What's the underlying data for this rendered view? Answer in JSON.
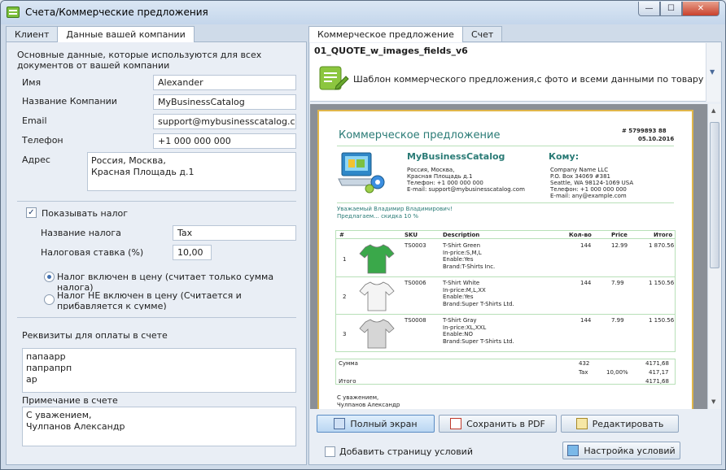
{
  "window": {
    "title": "Счета/Коммерческие предложения",
    "min": "—",
    "max": "☐",
    "close": "✕"
  },
  "left": {
    "tabs": [
      "Клиент",
      "Данные вашей компании"
    ],
    "intro": "Основные данные, которые используются для всех документов от вашей компании",
    "fields": [
      {
        "label": "Имя",
        "value": "Alexander"
      },
      {
        "label": "Название Компании",
        "value": "MyBusinessCatalog"
      },
      {
        "label": "Email",
        "value": "support@mybusinesscatalog.com"
      },
      {
        "label": "Телефон",
        "value": "+1 000 000 000"
      }
    ],
    "address_label": "Адрес",
    "address_value": "Россия, Москва,\nКрасная Площадь д.1",
    "show_tax": "Показывать налог",
    "tax_name_label": "Название налога",
    "tax_name_value": "Tax",
    "tax_rate_label": "Налоговая ставка (%)",
    "tax_rate_value": "10,00",
    "radio_included": "Налог включен в цену (считает только сумма налога)",
    "radio_not_included": "Налог НЕ включен в цену (Считается и прибавляется к сумме)",
    "payment_label": "Реквизиты для оплаты в счете",
    "payment_value": "папаарр\nпапрапрп\nар",
    "note_label": "Примечание в счете",
    "note_value": "С уважением,\nЧулпанов Александр"
  },
  "right": {
    "tabs": [
      "Коммерческое предложение",
      "Счет"
    ],
    "template_name": "01_QUOTE_w_images_fields_v6",
    "template_desc": "Шаблон коммерческого предложения,с фото и всеми данными по товару",
    "buttons": {
      "fullscreen": "Полный экран",
      "pdf": "Сохранить в PDF",
      "edit": "Редактировать",
      "terms": "Настройка условий"
    },
    "add_terms": "Добавить страницу условий"
  },
  "doc": {
    "title": "Коммерческое предложение",
    "number": "# 5799893 88",
    "date": "05.10.2016",
    "company": "MyBusinessCatalog",
    "to": "Кому:",
    "from_lines": [
      "Россия, Москва,",
      "Красная Площадь д.1",
      "Телефон: +1 000 000 000",
      "E-mail: support@mybusinesscatalog.com"
    ],
    "to_lines": [
      "Company Name LLC",
      "P.O. Box 34069 #381",
      "Seattle, WA 98124-1069 USA",
      "Телефон: +1 000 000 000",
      "E-mail: any@example.com"
    ],
    "greeting": "Уважаемый Владимир Владимирович!",
    "offer": "Предлагаем... скидка 10 %",
    "headers": [
      "#",
      "",
      "SKU",
      "Description",
      "Кол-во",
      "Price",
      "Итого"
    ],
    "rows": [
      {
        "n": "1",
        "sku": "TS0003",
        "desc": [
          "T-Shirt Green",
          "In-price:S,M,L",
          "Enable:Yes",
          "Brand:T-Shirts Inc."
        ],
        "qty": "144",
        "price": "12.99",
        "total": "1 870.56",
        "color": "#3aa84a"
      },
      {
        "n": "2",
        "sku": "TS0006",
        "desc": [
          "T-Shirt White",
          "In-price:M,L,XX",
          "Enable:Yes",
          "Brand:Super T-Shirts Ltd."
        ],
        "qty": "144",
        "price": "7.99",
        "total": "1 150.56",
        "color": "#f4f4f4"
      },
      {
        "n": "3",
        "sku": "TS0008",
        "desc": [
          "T-Shirt Gray",
          "In-price:XL,XXL",
          "Enable:NO",
          "Brand:Super T-Shirts Ltd."
        ],
        "qty": "144",
        "price": "7.99",
        "total": "1 150.56",
        "color": "#d6d6d6"
      }
    ],
    "sum_label": "Сумма",
    "sum_qty": "432",
    "sum_total": "4171,68",
    "tax_label": "Tax",
    "tax_rate": "10,00%",
    "tax_total": "417,17",
    "total_label": "Итого",
    "total_value": "4171,68",
    "closing": "С уважением,",
    "signer": "Чулпанов Александр"
  }
}
